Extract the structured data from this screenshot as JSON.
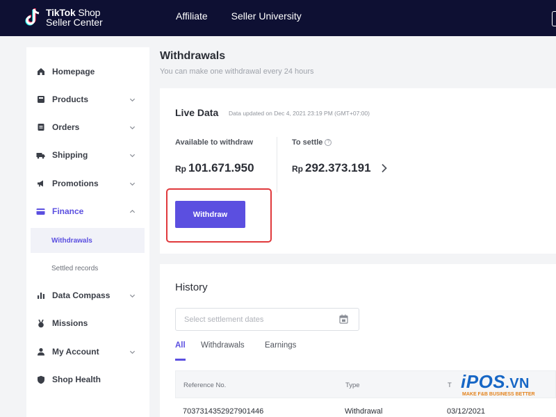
{
  "header": {
    "logo_line1_bold": "TikTok",
    "logo_line1_rest": " Shop",
    "logo_line2": "Seller Center",
    "nav": [
      "Affiliate",
      "Seller University"
    ]
  },
  "sidebar": {
    "items": [
      {
        "label": "Homepage",
        "icon": "home-icon"
      },
      {
        "label": "Products",
        "icon": "products-icon"
      },
      {
        "label": "Orders",
        "icon": "orders-icon"
      },
      {
        "label": "Shipping",
        "icon": "truck-icon"
      },
      {
        "label": "Promotions",
        "icon": "megaphone-icon"
      },
      {
        "label": "Finance",
        "icon": "card-icon",
        "expanded": true
      },
      {
        "label": "Data Compass",
        "icon": "bar-chart-icon"
      },
      {
        "label": "Missions",
        "icon": "medal-icon"
      },
      {
        "label": "My Account",
        "icon": "user-icon"
      },
      {
        "label": "Shop Health",
        "icon": "shield-icon"
      }
    ],
    "finance_sub": [
      {
        "label": "Withdrawals",
        "selected": true
      },
      {
        "label": "Settled records",
        "selected": false
      }
    ]
  },
  "main": {
    "title": "Withdrawals",
    "subtitle": "You can make one withdrawal every 24 hours",
    "live": {
      "title": "Live Data",
      "meta": "Data updated on Dec 4, 2021 23:19 PM (GMT+07:00)",
      "available_label": "Available to withdraw",
      "available_currency": "Rp",
      "available_value": "101.671.950",
      "settle_label": "To settle",
      "settle_currency": "Rp",
      "settle_value": "292.373.191",
      "withdraw_button": "Withdraw"
    },
    "history": {
      "title": "History",
      "date_placeholder": "Select settlement dates",
      "tabs": [
        "All",
        "Withdrawals",
        "Earnings"
      ],
      "columns": [
        "Reference No.",
        "Type",
        "T"
      ],
      "rows": [
        [
          "7037314352927901446",
          "Withdrawal",
          "03/12/2021"
        ]
      ]
    }
  },
  "watermark": {
    "brand": "iPOS",
    "brand_suffix": ".VN",
    "tagline": "MAKE F&B BUSINESS BETTER"
  },
  "colors": {
    "topbar": "#0e1033",
    "accent": "#5b4fe0",
    "highlight": "#e0383b",
    "brand_blue": "#1666c5",
    "brand_orange": "#e3821b"
  }
}
